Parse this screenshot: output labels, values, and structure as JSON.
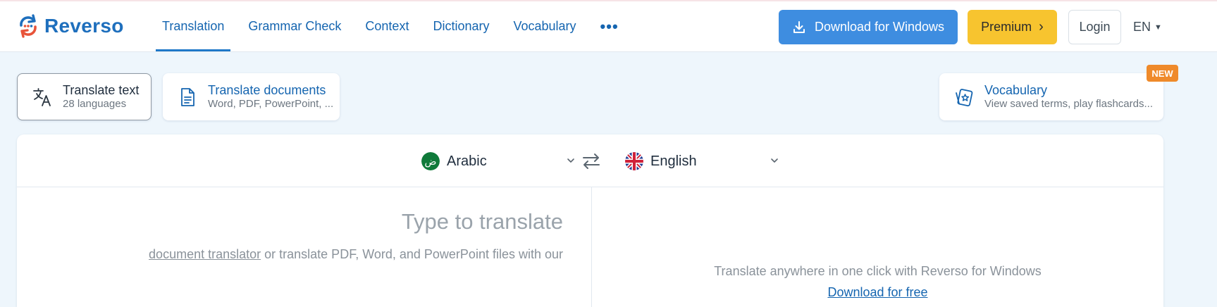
{
  "brand": {
    "name": "Reverso"
  },
  "nav": {
    "items": [
      {
        "label": "Translation",
        "active": true
      },
      {
        "label": "Grammar Check"
      },
      {
        "label": "Context"
      },
      {
        "label": "Dictionary"
      },
      {
        "label": "Vocabulary"
      }
    ],
    "more_label": "•••"
  },
  "header": {
    "download_label": "Download for Windows",
    "premium_label": "Premium",
    "login_label": "Login",
    "ui_language": "EN"
  },
  "cards": {
    "translate_text": {
      "title": "Translate text",
      "subtitle": "28 languages"
    },
    "translate_documents": {
      "title": "Translate documents",
      "subtitle": "Word, PDF, PowerPoint, ..."
    },
    "vocabulary": {
      "title": "Vocabulary",
      "subtitle": "View saved terms, play flashcards...",
      "badge": "NEW"
    }
  },
  "translator": {
    "source_language": "Arabic",
    "source_flag_glyph": "ض",
    "target_language": "English",
    "input_placeholder": "Type to translate",
    "hint_link": "document translator",
    "hint_text": " or translate PDF, Word, and PowerPoint files with our",
    "promo_text": "Translate anywhere in one click with Reverso for Windows",
    "promo_link": "Download for free"
  },
  "colors": {
    "brand_blue": "#1e6fbd",
    "download_button": "#3e8de0",
    "premium_button": "#f7c42f",
    "new_badge": "#ef8a2a",
    "arabic_flag": "#0f7a3a"
  }
}
